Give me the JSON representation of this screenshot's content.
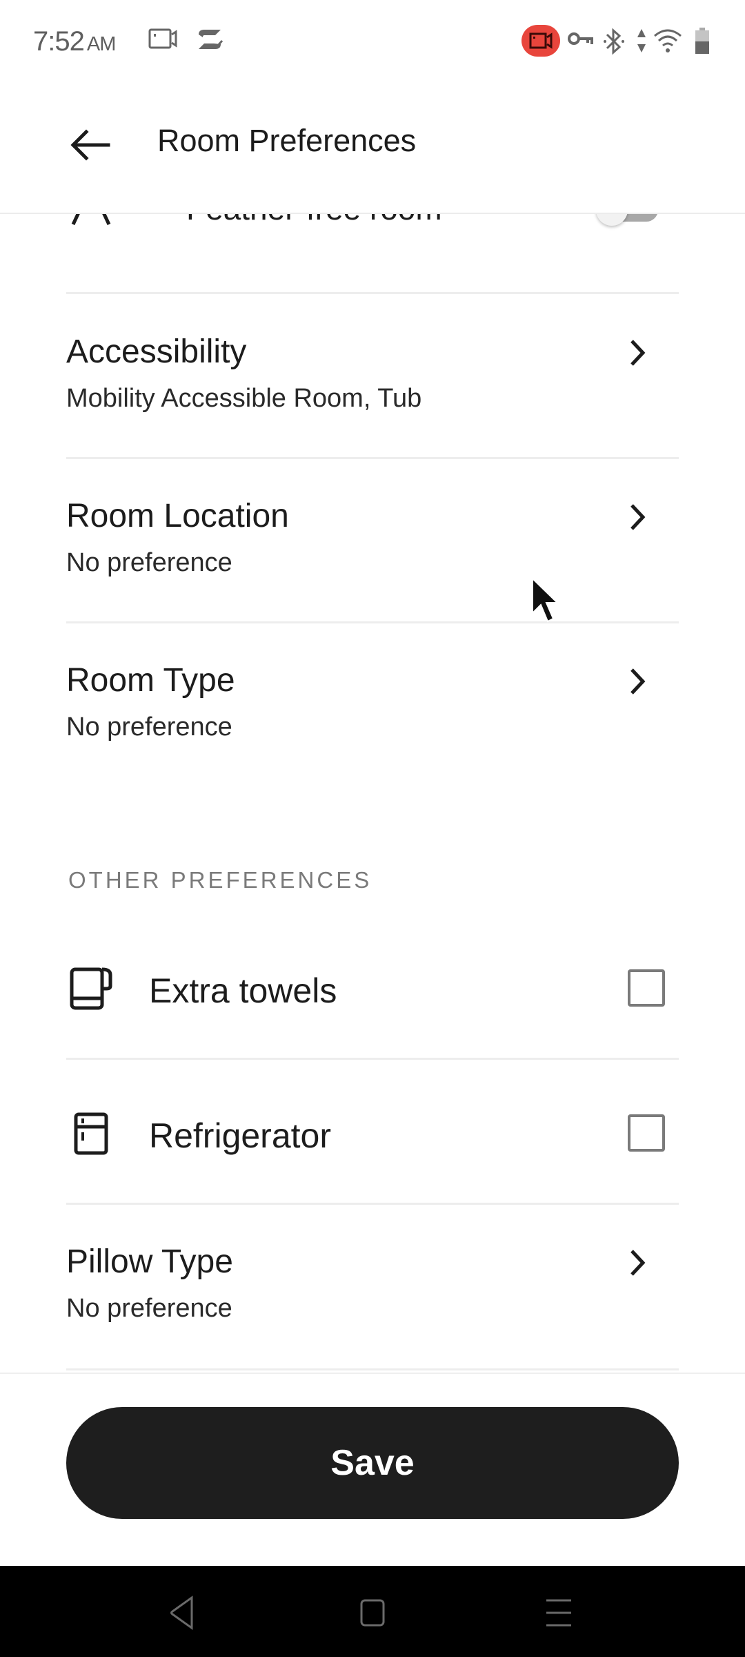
{
  "status_bar": {
    "time": "7:52",
    "ampm": "AM",
    "left_icons": [
      "screen-record-icon",
      "sync-check-icon"
    ],
    "right_icons": [
      "recording-badge-icon",
      "vpn-key-icon",
      "bluetooth-icon",
      "data-arrows-icon",
      "wifi-icon",
      "battery-icon"
    ],
    "record_badge_color": "#e8453c"
  },
  "header": {
    "back_icon": "arrow-left-icon",
    "title": "Room Preferences"
  },
  "partial_row": {
    "label": "Feather-free room",
    "icon": "feather-free-icon",
    "toggle_on": false
  },
  "nav_rows": [
    {
      "title": "Accessibility",
      "value": "Mobility Accessible Room, Tub"
    },
    {
      "title": "Room Location",
      "value": "No preference"
    },
    {
      "title": "Room Type",
      "value": "No preference"
    }
  ],
  "other_preferences": {
    "section_title": "OTHER PREFERENCES",
    "checkbox_items": [
      {
        "label": "Extra towels",
        "icon": "towel-icon",
        "checked": false
      },
      {
        "label": "Refrigerator",
        "icon": "refrigerator-icon",
        "checked": false
      }
    ],
    "nav_rows": [
      {
        "title": "Pillow Type",
        "value": "No preference"
      }
    ]
  },
  "footer": {
    "save_label": "Save",
    "button_color": "#1e1e1e"
  },
  "system_nav": {
    "buttons": [
      "back",
      "home",
      "recents"
    ]
  }
}
